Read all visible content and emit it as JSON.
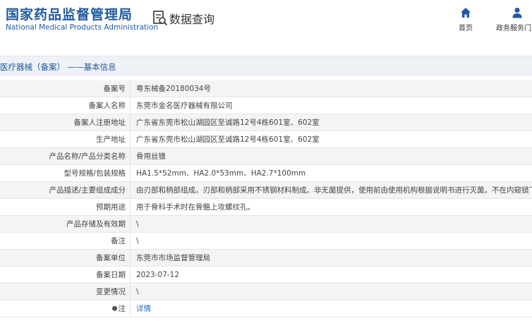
{
  "header": {
    "logo_cn": "国家药品监督管理局",
    "logo_en": "National Medical Products Administration",
    "query_label": "数据查询",
    "query_icon": "search-document-icon",
    "nav": [
      {
        "label": "首页",
        "icon": "home-icon"
      },
      {
        "label": "政务服务门户",
        "icon": "user-icon"
      }
    ]
  },
  "breadcrumb": "医疗器械（备案） ——基本信息",
  "colors": {
    "brand": "#1f5aa0",
    "link": "#1f6fc5",
    "band": "#eef1f5",
    "row_alt": "#f4f4f4"
  },
  "rows": [
    {
      "key": "备案号",
      "value": "粤东械备20180034号"
    },
    {
      "key": "备案人名称",
      "value": "东莞市金名医疗器械有限公司"
    },
    {
      "key": "备案人注册地址",
      "value": "广东省东莞市松山湖园区至诚路12号4栋601室、602室"
    },
    {
      "key": "生产地址",
      "value": "广东省东莞市松山湖园区至诚路12号4栋601室、602室"
    },
    {
      "key": "产品名称/产品分类名称",
      "value": "骨用丝锥"
    },
    {
      "key": "型号规格/包装规格",
      "value": "HA1.5*52mm、HA2.0*53mm、HA2.7*100mm"
    },
    {
      "key": "产品描述/主要组成成分",
      "value": "由刃部和柄部组成。刃部和柄部采用不锈钢材料制成。非无菌提供，使用前由使用机构根据说明书进行灭菌。不在内窥镜下使用。"
    },
    {
      "key": "预期用途",
      "value": "用于骨科手术时在骨骼上攻螺纹孔。"
    },
    {
      "key": "产品存储及有效期",
      "value": "\\"
    },
    {
      "key": "备注",
      "value": "\\"
    },
    {
      "key": "备案单位",
      "value": "东莞市市场监督管理局"
    },
    {
      "key": "备案日期",
      "value": "2023-07-12"
    },
    {
      "key": "变更情况",
      "value": "\\"
    },
    {
      "key": "注",
      "value": "详情",
      "icon": "lightbulb-icon"
    }
  ]
}
